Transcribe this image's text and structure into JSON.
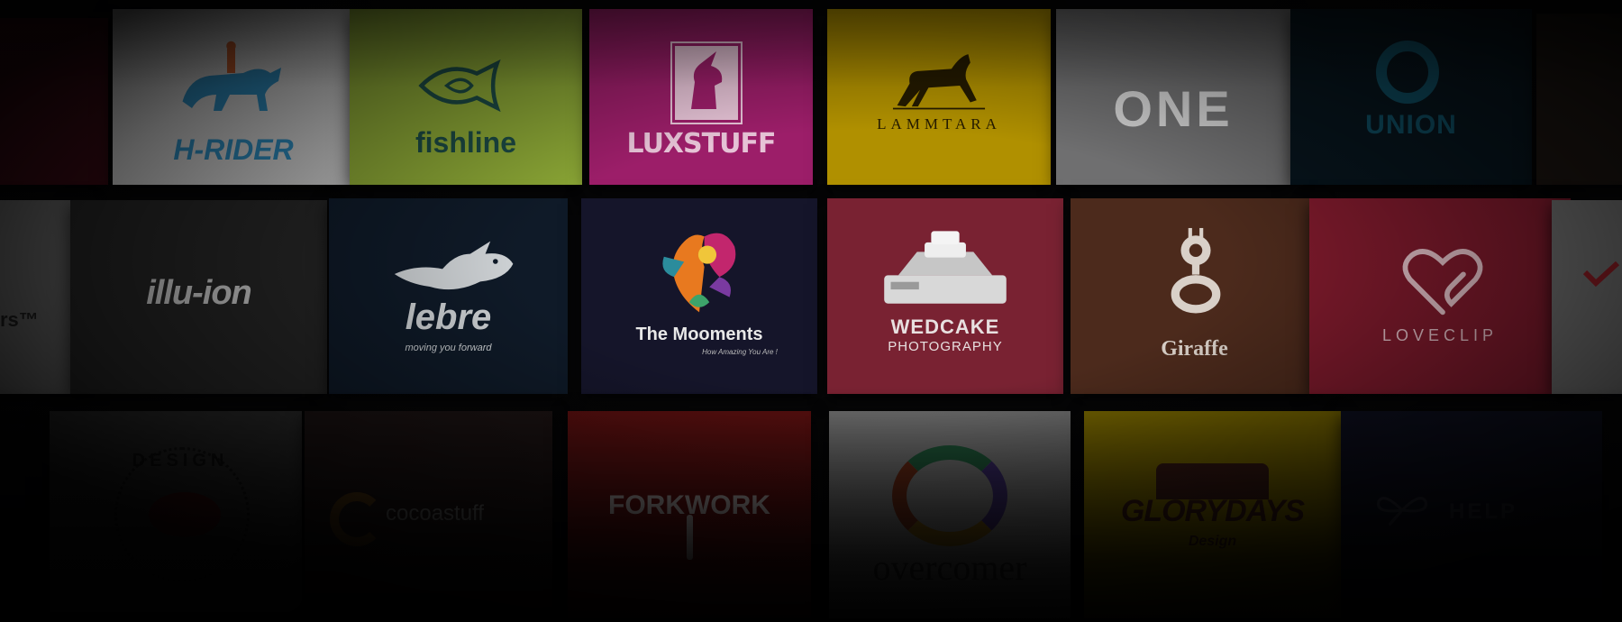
{
  "scene": "logo portfolio wall",
  "tiles": [
    {
      "id": "h-rider",
      "text": "H-RIDER",
      "bg": "#c9c9c9",
      "color": "#2c86b6",
      "icon": "horse-rider-icon"
    },
    {
      "id": "fishline",
      "text": "fishline",
      "bg": "#8aa535",
      "color": "#1c4a44",
      "icon": "fish-icon"
    },
    {
      "id": "luxstuff",
      "text": "LUXSTUFF",
      "bg": "#9c1e69",
      "color": "#e6c3d6",
      "icon": "unicorn-icon"
    },
    {
      "id": "lammtara",
      "text": "LAMMTARA",
      "bg": "#b09000",
      "color": "#241a00",
      "icon": "horse-icon"
    },
    {
      "id": "one",
      "text": "ONE",
      "bg": "#6f6f70",
      "color": "#cfcfcf",
      "icon": "one-logo-icon"
    },
    {
      "id": "union",
      "text": "UNION",
      "bg": "#07141c",
      "color": "#0e4a5e",
      "icon": "ring-icon"
    },
    {
      "id": "illusion",
      "text": "illu-ion",
      "bg": "#272727",
      "color": "#d2d2d2",
      "icon": "wordmark"
    },
    {
      "id": "lebre",
      "text": "lebre",
      "tagline": "moving you forward",
      "bg": "#0f1a28",
      "color": "#cfd3d6",
      "icon": "hare-icon"
    },
    {
      "id": "moments",
      "text": "The Mooments",
      "tagline": "How Amazing You Are !",
      "bg": "#15152a",
      "color": "#e8e8e8",
      "icon": "colorful-flower-icon"
    },
    {
      "id": "wedcake",
      "text": "WEDCAKE",
      "subtext": "PHOTOGRAPHY",
      "bg": "#792232",
      "color": "#e8e0e0",
      "icon": "camera-cake-icon"
    },
    {
      "id": "giraffe",
      "text": "Giraffe",
      "bg": "#4c2a1c",
      "color": "#d9d0c8",
      "icon": "giraffe-g-icon"
    },
    {
      "id": "loveclip",
      "text": "LOVECLIP",
      "bg": "#7e1a2c",
      "color": "#e2bfc6",
      "icon": "heart-clip-icon"
    },
    {
      "id": "design",
      "text": "DESIGN",
      "bg": "#2f2f2f",
      "color": "#111111",
      "icon": "badge-icon"
    },
    {
      "id": "cocoastuff",
      "text": "cocoastuff",
      "bg": "#1d1414",
      "color": "#6a6a6a",
      "icon": "c-swirl-icon"
    },
    {
      "id": "forkwork",
      "text": "FORKWORK",
      "bg": "#5f1010",
      "color": "#b9b0b0",
      "icon": "fork-icon"
    },
    {
      "id": "overcomer",
      "text": "overcomer",
      "bg": "#767676",
      "color": "#2f2f2f",
      "icon": "ring-gradient-icon"
    },
    {
      "id": "glorydays",
      "text": "GLORYDAYS",
      "subtext": "Design",
      "bg": "#7d6b00",
      "color": "#3a1a14",
      "icon": "camera-badge-icon"
    },
    {
      "id": "help",
      "text": "HELP",
      "bg": "#0e1020",
      "color": "#2d2f3d",
      "icon": "butterfly-icon"
    }
  ]
}
